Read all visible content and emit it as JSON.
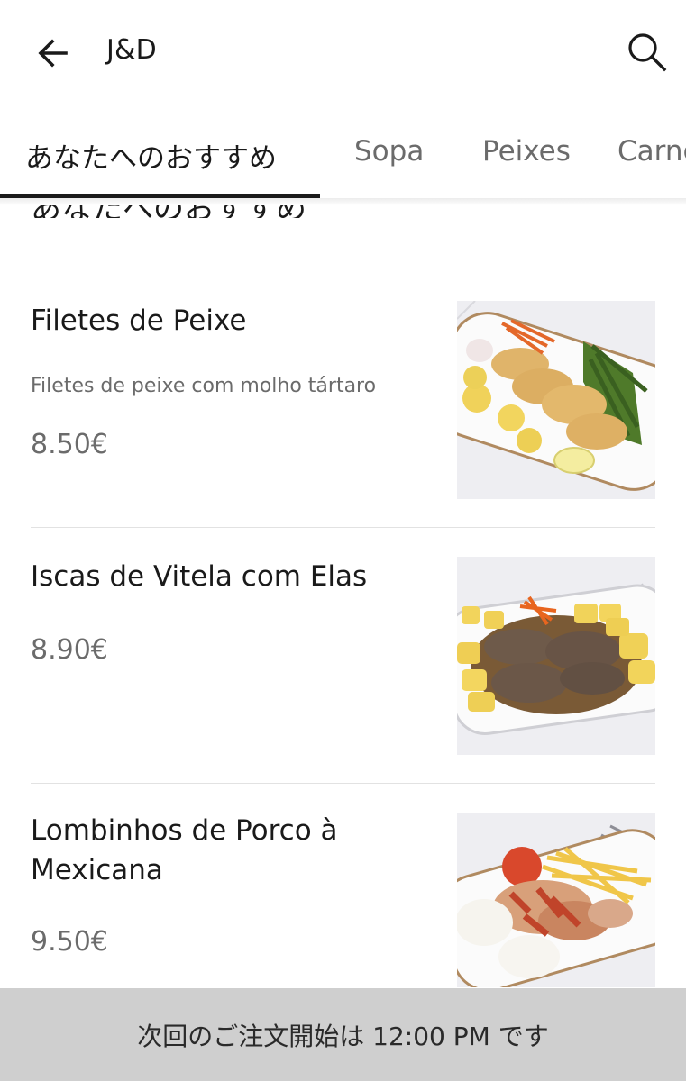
{
  "header": {
    "title": "J&D",
    "back_icon": "arrow-left-icon",
    "search_icon": "search-icon"
  },
  "tabs": [
    {
      "label": "あなたへのおすすめ",
      "active": true
    },
    {
      "label": "Sopa",
      "active": false
    },
    {
      "label": "Peixes",
      "active": false
    },
    {
      "label": "Carne",
      "active": false
    }
  ],
  "section": {
    "title": "あなたへのおすすめ"
  },
  "menu_items": [
    {
      "name": "Filetes de Peixe",
      "description": "Filetes de peixe com molho tártaro",
      "price": "8.50€"
    },
    {
      "name": "Iscas de Vitela com Elas",
      "description": "",
      "price": "8.90€"
    },
    {
      "name": "Lombinhos de Porco à Mexicana",
      "description": "",
      "price": "9.50€"
    }
  ],
  "banner": {
    "text": "次回のご注文開始は 12:00 PM です"
  },
  "colors": {
    "banner_bg": "#cfcfcf",
    "active_tab": "#1a1a1a",
    "inactive_tab": "#6b6b6b",
    "price": "#6b6b6b"
  }
}
